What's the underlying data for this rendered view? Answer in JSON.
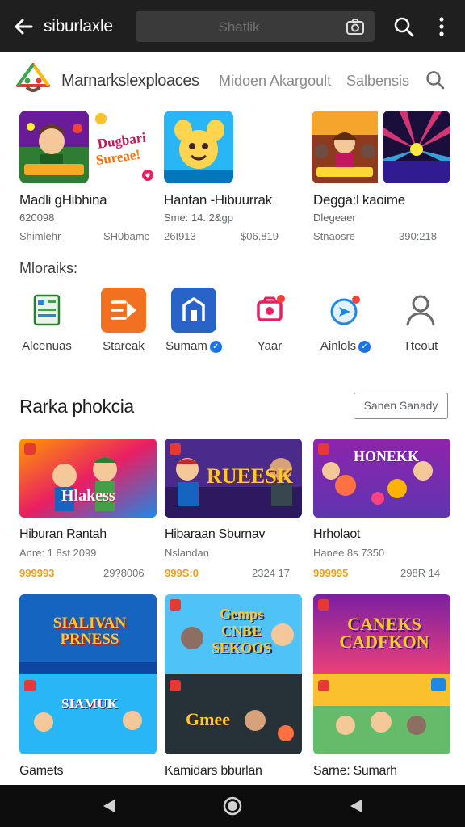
{
  "topbar": {
    "title": "siburlaxle",
    "search_placeholder": "Shatlik"
  },
  "nav": {
    "title": "Marnarkslexploaces",
    "tabs": [
      "Midoen Akargoult",
      "Salbensis"
    ]
  },
  "featured": [
    {
      "title": "Madli gHibhina",
      "sub": "620098",
      "meta_left": "Shimlehr",
      "meta_right": "SH0bamc"
    },
    {
      "title": "Hantan -Hibuurrak",
      "sub": "Sme: 14. 2&gp",
      "meta_left": "26I913",
      "meta_right": "$06.819"
    },
    {
      "title": "Degga:l kaoime",
      "sub": "Dlegeaer",
      "meta_left": "Stnaosre",
      "meta_right": "390:218"
    }
  ],
  "quick_label": "Mloraiks:",
  "quick_icons": [
    {
      "label": "Alcenuas",
      "color": "#ffffff",
      "icon": "form-icon"
    },
    {
      "label": "Stareak",
      "color": "#f2701f",
      "icon": "play-forward-icon"
    },
    {
      "label": "Sumam",
      "color": "#2a63c8",
      "icon": "home-icon",
      "badge": "✓"
    },
    {
      "label": "Yaar",
      "color": "#ffffff",
      "icon": "camera-icon"
    },
    {
      "label": "Ainlols",
      "color": "#ffffff",
      "icon": "send-icon",
      "badge": "✓"
    },
    {
      "label": "Tteout",
      "color": "#ffffff",
      "icon": "person-icon"
    }
  ],
  "section": {
    "title": "Rarka phokcia",
    "button": "Sanen Sanady"
  },
  "games": [
    {
      "title": "Hiburan Rantah",
      "sub": "Anre: 1 8st 2099",
      "price": "999993",
      "count": "29?8006",
      "banner": "Hlakess"
    },
    {
      "title": "Hibaraan Sburnav",
      "sub": "Nslandan",
      "price": "999S:0",
      "count": "2324 17",
      "banner": "RUEESK"
    },
    {
      "title": "Hrholaot",
      "sub": "Hanee 8s 7350",
      "price": "999995",
      "count": "298R 14",
      "banner": "HONEKK"
    },
    {
      "title": "Gamets",
      "banner": "SIALIVAN PRNESS",
      "banner2": "SIAMUK"
    },
    {
      "title": "Kamidars bburlan",
      "banner": "Gemps CNBE SEKOOS",
      "banner2": "Gmee"
    },
    {
      "title": "Sarne: Sumarh",
      "banner": "CANEKS CADFKON",
      "banner2": ""
    }
  ]
}
